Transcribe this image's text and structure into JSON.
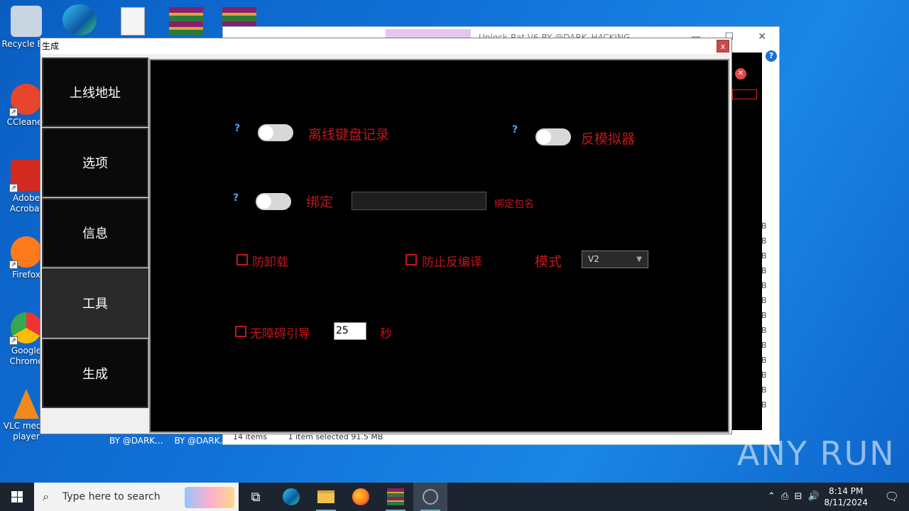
{
  "desktop": {
    "icons": [
      {
        "label": "Recycle Bin",
        "color": "#c9d6e2"
      },
      {
        "label": "CCleaner",
        "color": "#e7452c"
      },
      {
        "label": "Adobe Acrobat",
        "color": "#d22a1e"
      },
      {
        "label": "Firefox",
        "color": "#ff7a1a"
      },
      {
        "label": "Google Chrome",
        "color": "#2a9d4a"
      },
      {
        "label": "VLC media player",
        "color": "#f08a1c"
      }
    ],
    "taskbar_window_labels": [
      "BY @DARK...",
      "BY @DARK..."
    ]
  },
  "explorer": {
    "title": "Unlock-Rat-V6 BY @DARK_H4CKING",
    "status_items": "14 items",
    "status_selected": "1 item selected  91.5 MB",
    "size_suffix": "B"
  },
  "dialog": {
    "title": "生成",
    "close_label": "x",
    "sidebar": [
      {
        "label": "上线地址"
      },
      {
        "label": "选项"
      },
      {
        "label": "信息"
      },
      {
        "label": "工具"
      },
      {
        "label": "生成"
      }
    ],
    "options": {
      "offline_keylogger": "离线键盘记录",
      "anti_emulator": "反模拟器",
      "bind": "绑定",
      "bind_package_hint": "绑定包名",
      "anti_uninstall": "防卸载",
      "anti_decompile": "防止反编译",
      "mode_label": "模式",
      "mode_value": "V2",
      "accessibility_guide": "无障碍引导",
      "seconds_value": "25",
      "seconds_unit": "秒",
      "help_mark": "?"
    }
  },
  "watermark": "ANY RUN",
  "taskbar": {
    "search_placeholder": "Type here to search",
    "time": "8:14 PM",
    "date": "8/11/2024"
  }
}
